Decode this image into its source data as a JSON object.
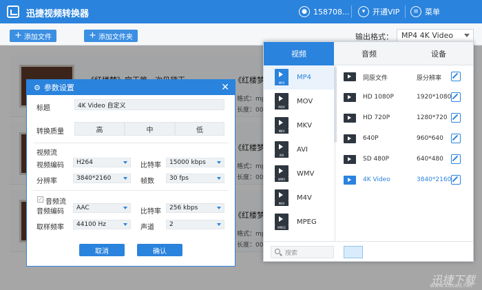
{
  "app": {
    "title": "迅捷视频转换器"
  },
  "titlebar": {
    "user": "158708...",
    "vip": "开通VIP",
    "menu": "菜单"
  },
  "toolbar": {
    "add_file": "添加文件",
    "add_folder": "添加文件夹",
    "output_label": "输出格式：",
    "output_value": "MP4  4K Video"
  },
  "files": [
    {
      "title": "《红楼梦》宝玉第一次见黛玉...",
      "title2": "《红楼梦",
      "meta1": "格式：mp",
      "meta2": "长度：00"
    },
    {
      "title": "",
      "title2": "《红楼梦",
      "meta1": "格式：mp",
      "meta2": "长度：00"
    },
    {
      "title": "",
      "title2": "《红楼梦",
      "meta1": "格式：mp",
      "meta2": "长度：00"
    }
  ],
  "dialog": {
    "title": "参数设置",
    "title_label": "标题",
    "title_value": "4K Video 自定义",
    "quality_label": "转换质量",
    "quality_options": [
      "高",
      "中",
      "低"
    ],
    "video_stream": "视频流",
    "video_codec_label": "视频编码",
    "video_codec": "H264",
    "bitrate_label": "比特率",
    "video_bitrate": "15000 kbps",
    "resolution_label": "分辨率",
    "resolution": "3840*2160",
    "fps_label": "帧数",
    "fps": "30 fps",
    "audio_stream": "音频流",
    "audio_codec_label": "音频编码",
    "audio_codec": "AAC",
    "audio_bitrate_label": "比特率",
    "audio_bitrate": "256 kbps",
    "samplerate_label": "取样频率",
    "samplerate": "44100 Hz",
    "channel_label": "声道",
    "channel": "2",
    "cancel": "取消",
    "confirm": "确认"
  },
  "format_panel": {
    "tabs": [
      "视频",
      "音频",
      "设备"
    ],
    "formats": [
      {
        "name": "MP4",
        "tag": "MP4"
      },
      {
        "name": "MOV",
        "tag": "MOV"
      },
      {
        "name": "MKV",
        "tag": "MKV"
      },
      {
        "name": "AVI",
        "tag": "AVI"
      },
      {
        "name": "WMV",
        "tag": "WMV"
      },
      {
        "name": "M4V",
        "tag": "M4V"
      },
      {
        "name": "MPEG",
        "tag": "MPEG"
      }
    ],
    "presets": [
      {
        "name": "同原文件",
        "res": "原分辨率"
      },
      {
        "name": "HD 1080P",
        "res": "1920*1080"
      },
      {
        "name": "HD 720P",
        "res": "1280*720"
      },
      {
        "name": "640P",
        "res": "960*640"
      },
      {
        "name": "SD 480P",
        "res": "640*480"
      },
      {
        "name": "4K Video",
        "res": "3840*2160"
      }
    ],
    "search_placeholder": "搜索"
  },
  "watermark": {
    "text": "迅捷下载",
    "url": "www.xdoad.net"
  }
}
